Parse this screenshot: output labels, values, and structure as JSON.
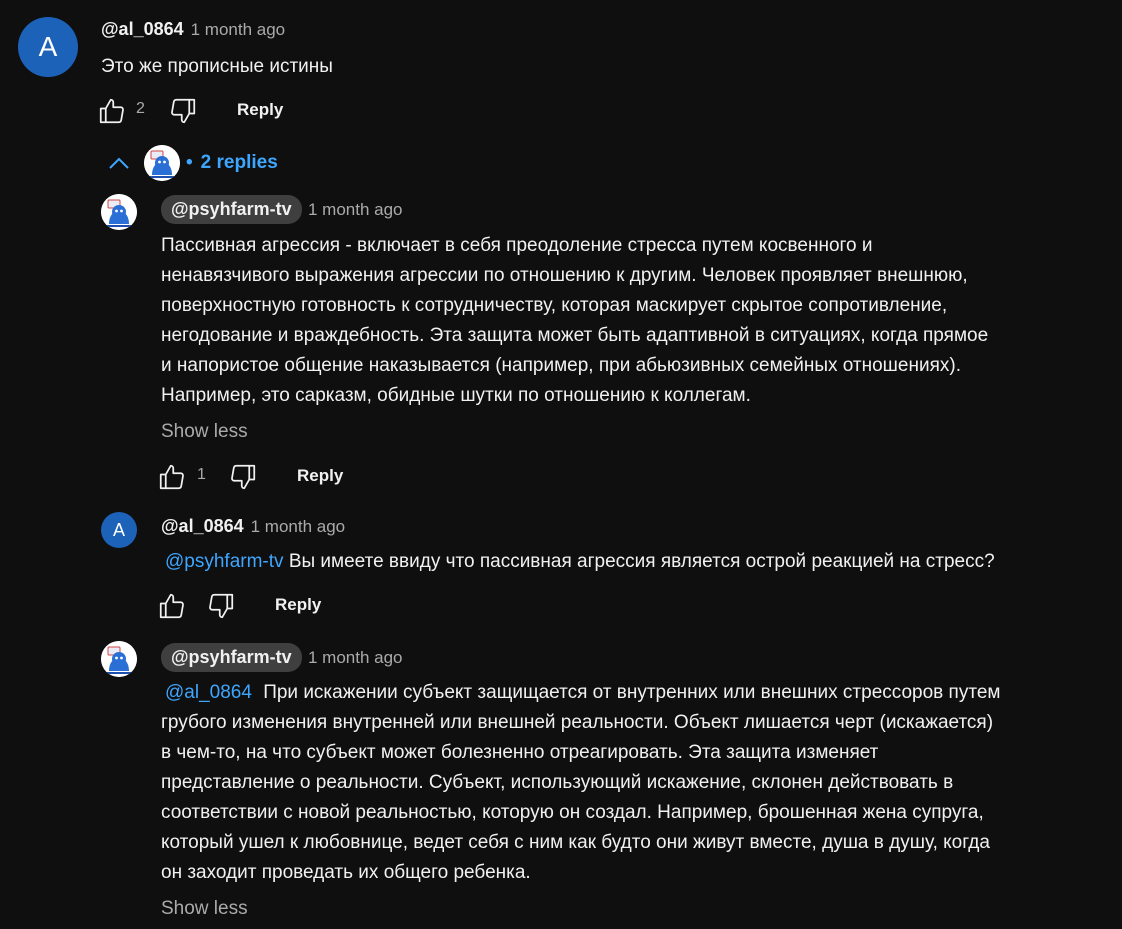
{
  "comment": {
    "avatar_letter": "A",
    "author": "@al_0864",
    "time": "1 month ago",
    "text": "Это же прописные истины",
    "likes": "2",
    "reply_label": "Reply",
    "replies_toggle": {
      "bullet": "•",
      "label": "2 replies"
    }
  },
  "replies": [
    {
      "author": "@psyhfarm-tv",
      "time": "1 month ago",
      "lines": [
        "Пассивная агрессия - включает в себя преодоление стресса путем косвенного и",
        "ненавязчивого выражения агрессии по отношению к другим. Человек проявляет внешнюю,",
        "поверхностную готовность к сотрудничеству, которая маскирует скрытое сопротивление,",
        "негодование и враждебность. Эта защита может быть адаптивной в ситуациях, когда прямое",
        "и напористое общение наказывается (например, при абьюзивных семейных отношениях).",
        "Например, это сарказм, обидные шутки по отношению к коллегам."
      ],
      "show_less": "Show less",
      "likes": "1",
      "reply_label": "Reply"
    },
    {
      "avatar_letter": "A",
      "author": "@al_0864",
      "time": "1 month ago",
      "mention": "@psyhfarm-tv",
      "text": "Вы имеете ввиду что пассивная агрессия является острой реакцией на стресс?",
      "reply_label": "Reply"
    },
    {
      "author": "@psyhfarm-tv",
      "time": "1 month ago",
      "mention": "@al_0864",
      "first_line_rest": "При искажении субъект защищается от внутренних или внешних стрессоров путем",
      "lines": [
        "грубого изменения внутренней или внешней реальности. Объект лишается черт (искажается)",
        "в чем-то, на что субъект может болезненно отреагировать. Эта защита изменяет",
        "представление о реальности. Субъект, использующий искажение, склонен действовать в",
        "соответствии с новой реальностью, которую он создал. Например, брошенная жена супруга,",
        "который ушел к любовнице, ведет себя с ним как будто они живут вместе, душа в душу, когда",
        "он заходит проведать их общего ребенка."
      ],
      "show_less": "Show less"
    }
  ],
  "colors": {
    "background": "#0f0f0f",
    "text": "#f1f1f1",
    "secondary": "#aaaaaa",
    "link": "#3ea6ff",
    "avatar": "#1c62b9",
    "chip": "#3f3f3f"
  }
}
